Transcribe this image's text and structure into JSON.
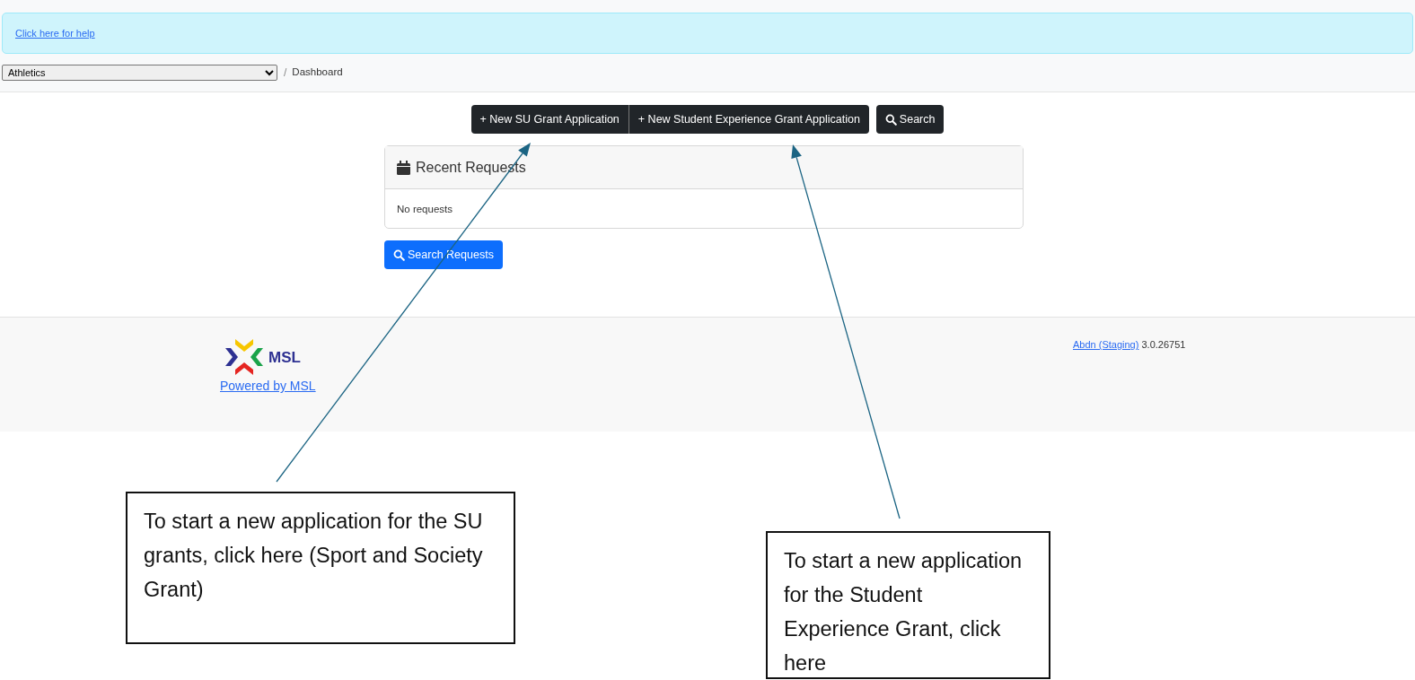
{
  "help_link": "Click here for help",
  "breadcrumb": {
    "group_select": "Athletics",
    "separator": "/",
    "current": "Dashboard"
  },
  "actions": [
    {
      "label": "+ New SU Grant Application"
    },
    {
      "label": "+ New Student Experience Grant Application"
    }
  ],
  "search_button": "Search",
  "recent_requests": {
    "title": "Recent Requests",
    "empty_text": "No requests"
  },
  "search_requests_button": "Search Requests",
  "footer": {
    "logo_text": "MSL",
    "powered_link": "Powered by MSL",
    "site_link": "Abdn (Staging)",
    "version": "3.0.26751"
  },
  "annotations": [
    {
      "text": "To start a new application for the SU grants, click here (Sport and Society Grant)"
    },
    {
      "text": "To start a new application for the Student Experience Grant, click here"
    }
  ]
}
